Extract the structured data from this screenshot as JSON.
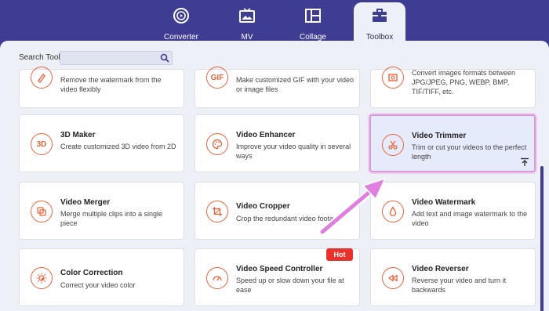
{
  "tabs": [
    {
      "label": "Converter",
      "icon": "converter-icon"
    },
    {
      "label": "MV",
      "icon": "mv-icon"
    },
    {
      "label": "Collage",
      "icon": "collage-icon"
    },
    {
      "label": "Toolbox",
      "icon": "toolbox-icon",
      "active": true
    }
  ],
  "search": {
    "label": "Search Tool:",
    "placeholder": "",
    "value": ""
  },
  "tools": [
    {
      "title": "",
      "desc": "Remove the watermark from the video flexibly",
      "icon": "watermark-remover-icon"
    },
    {
      "title": "",
      "desc": "Make customized GIF with your video or image files",
      "icon": "gif-icon",
      "icon_text": "GIF"
    },
    {
      "title": "",
      "desc": "Convert images formats between JPG/JPEG, PNG, WEBP, BMP, TIF/TIFF, etc.",
      "icon": "image-converter-icon"
    },
    {
      "title": "3D Maker",
      "desc": "Create customized 3D video from 2D",
      "icon": "3d-icon",
      "icon_text": "3D"
    },
    {
      "title": "Video Enhancer",
      "desc": "Improve your video quality in several ways",
      "icon": "palette-icon"
    },
    {
      "title": "Video Trimmer",
      "desc": "Trim or cut your videos to the perfect length",
      "icon": "scissors-icon",
      "selected": true
    },
    {
      "title": "Video Merger",
      "desc": "Merge multiple clips into a single piece",
      "icon": "merge-icon"
    },
    {
      "title": "Video Cropper",
      "desc": "Crop the redundant video footage",
      "icon": "crop-icon"
    },
    {
      "title": "Video Watermark",
      "desc": "Add text and image watermark to the video",
      "icon": "droplet-icon"
    },
    {
      "title": "Color Correction",
      "desc": "Correct your video color",
      "icon": "sun-icon"
    },
    {
      "title": "Video Speed Controller",
      "desc": "Speed up or slow down your file at ease",
      "icon": "speedometer-icon"
    },
    {
      "title": "Video Reverser",
      "desc": "Reverse your video and turn it backwards",
      "icon": "rewind-icon"
    }
  ],
  "hot_badge": "Hot",
  "colors": {
    "brand": "#3f3c93",
    "accent": "#f0633a",
    "highlight": "#e07fe0",
    "hot": "#e8322b"
  }
}
